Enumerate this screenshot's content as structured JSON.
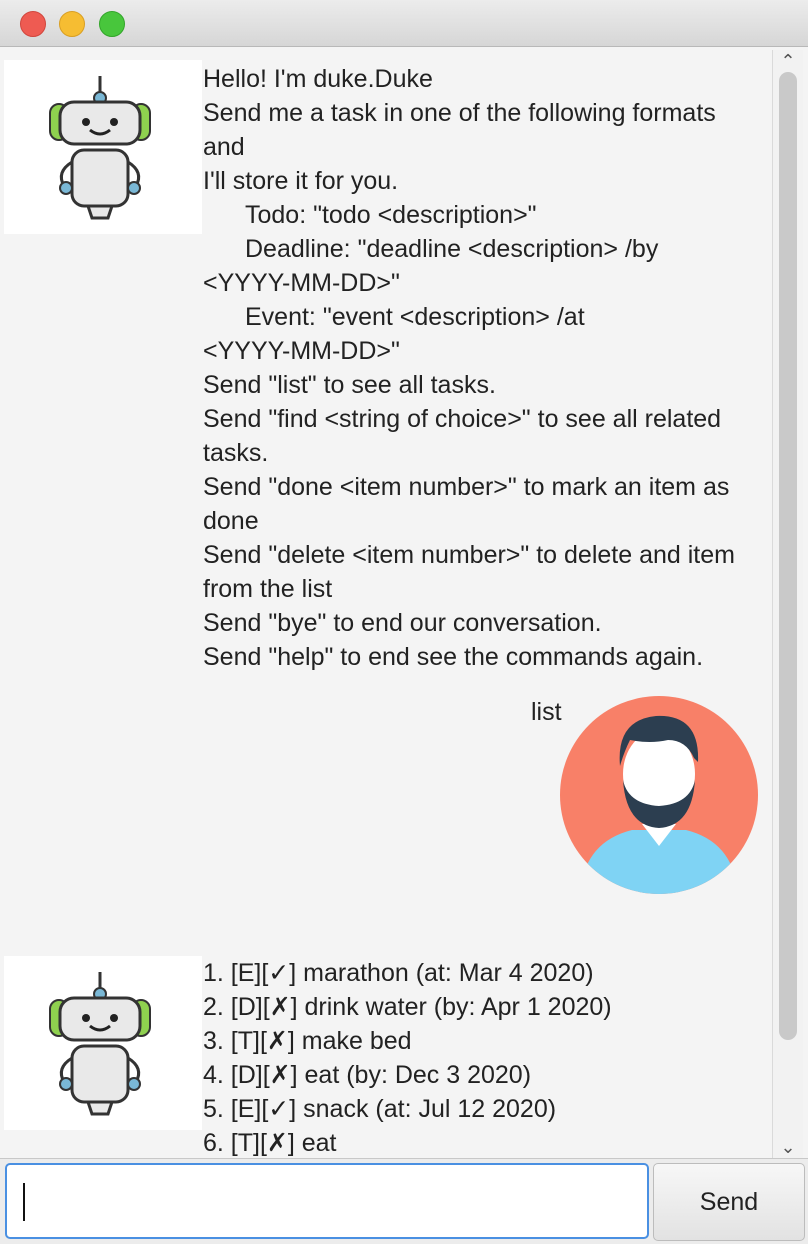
{
  "window": {
    "title": ""
  },
  "chat": {
    "welcome_lines": [
      {
        "text": "Hello! I'm duke.Duke",
        "indent": false
      },
      {
        "text": "Send me a task in one of the following formats and",
        "indent": false
      },
      {
        "text": "I'll store it for you.",
        "indent": false
      },
      {
        "text": "Todo: \"todo <description>\"",
        "indent": true
      },
      {
        "text": "Deadline: \"deadline <description> /by",
        "indent": true
      },
      {
        "text": "<YYYY-MM-DD>\"",
        "indent": false
      },
      {
        "text": "Event: \"event <description> /at",
        "indent": true
      },
      {
        "text": "<YYYY-MM-DD>\"",
        "indent": false
      },
      {
        "text": "Send \"list\" to see all tasks.",
        "indent": false
      },
      {
        "text": "Send \"find <string of choice>\" to see all related",
        "indent": false
      },
      {
        "text": "tasks.",
        "indent": false
      },
      {
        "text": "Send \"done <item number>\" to mark an item as",
        "indent": false
      },
      {
        "text": "done",
        "indent": false
      },
      {
        "text": "Send \"delete <item number>\" to delete and item",
        "indent": false
      },
      {
        "text": "from the list",
        "indent": false
      },
      {
        "text": "Send \"bye\" to end our conversation.",
        "indent": false
      },
      {
        "text": "Send \"help\" to end see the commands again.",
        "indent": false
      }
    ],
    "user_message": "list",
    "task_lines": [
      "1. [E][✓] marathon (at: Mar 4 2020)",
      "2. [D][✗] drink water (by: Apr 1 2020)",
      "3. [T][✗] make bed",
      "4. [D][✗] eat (by: Dec 3 2020)",
      "5. [E][✓] snack (at: Jul 12 2020)",
      "6. [T][✗] eat"
    ]
  },
  "input": {
    "value": "",
    "placeholder": ""
  },
  "send_button": {
    "label": "Send"
  },
  "colors": {
    "user_avatar_bg": "#f88068",
    "user_hair": "#2c3e50",
    "user_shirt": "#7fd3f4",
    "bot_accent": "#8fd14f",
    "input_focus": "#4a90e2"
  },
  "icons": {
    "bot_avatar": "robot-icon",
    "user_avatar": "bearded-man-icon",
    "scroll_up": "chevron-up-icon",
    "scroll_down": "chevron-down-icon"
  }
}
